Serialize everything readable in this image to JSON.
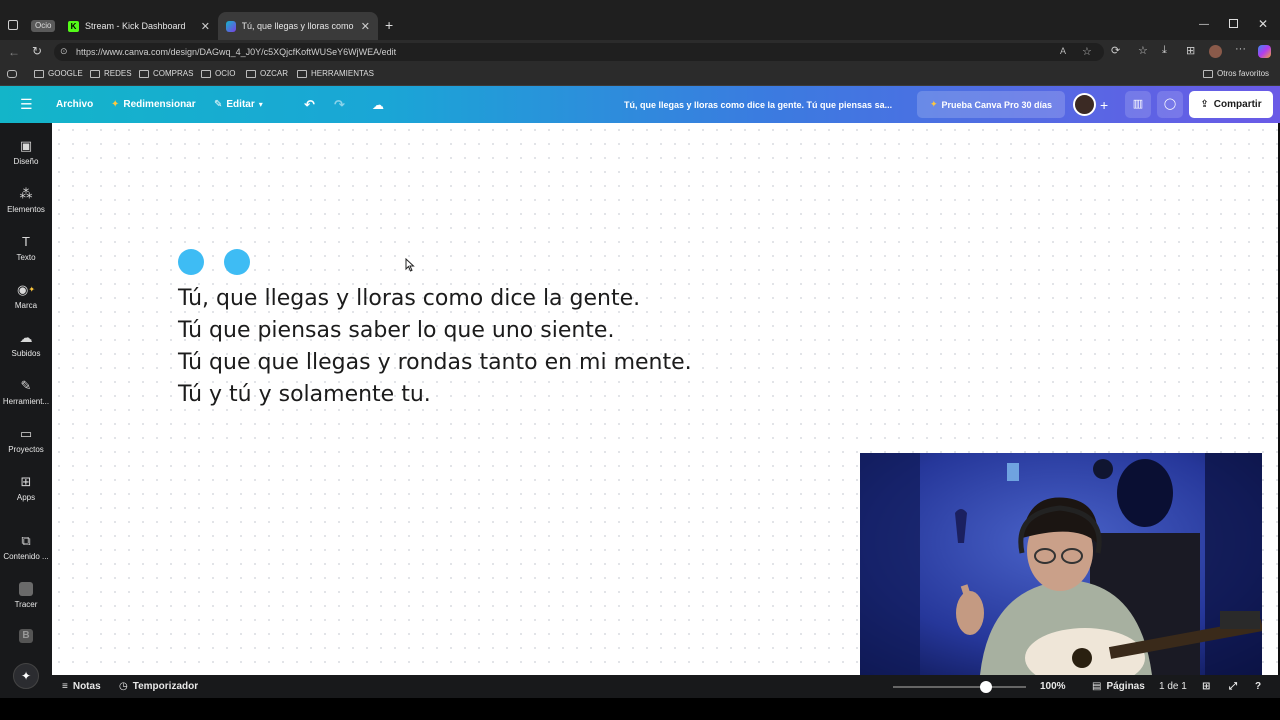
{
  "browser": {
    "tabs": [
      {
        "label": "Ocio",
        "kind": "group"
      },
      {
        "label": "Stream - Kick Dashboard"
      },
      {
        "label": "Tú, que llegas y lloras como dice"
      }
    ],
    "url": "https://www.canva.com/design/DAGwq_4_J0Y/c5XQjcfKoftWUSeY6WjWEA/edit",
    "bookmarks": [
      "GOOGLE",
      "REDES",
      "COMPRAS",
      "OCIO",
      "OZCAR",
      "HERRAMIENTAS"
    ],
    "other_bookmarks": "Otros favoritos"
  },
  "canva": {
    "menu": {
      "archivo": "Archivo",
      "redimensionar": "Redimensionar",
      "editar": "Editar"
    },
    "doc_title": "Tú, que llegas y lloras como dice la gente. Tú que piensas sa...",
    "pro_trial": "Prueba Canva Pro 30 días",
    "share": "Compartir",
    "rail": [
      {
        "label": "Diseño",
        "icon": "layout-icon"
      },
      {
        "label": "Elementos",
        "icon": "elements-icon"
      },
      {
        "label": "Texto",
        "icon": "text-icon"
      },
      {
        "label": "Marca",
        "icon": "brand-icon"
      },
      {
        "label": "Subidos",
        "icon": "upload-icon"
      },
      {
        "label": "Herramient...",
        "icon": "pen-icon"
      },
      {
        "label": "Proyectos",
        "icon": "folder-icon"
      },
      {
        "label": "Apps",
        "icon": "apps-icon"
      },
      {
        "label": "Contenido ...",
        "icon": "content-icon"
      },
      {
        "label": "Tracer",
        "icon": "tracer-icon"
      }
    ],
    "lyrics": [
      "Tú, que llegas y lloras como dice la gente.",
      "Tú que piensas saber lo que uno siente.",
      "Tú que que llegas y rondas tanto en mi mente.",
      "Tú y tú y solamente tu."
    ],
    "footer": {
      "notes": "Notas",
      "timer": "Temporizador",
      "zoom": "100%",
      "zoom_level": 0.7,
      "pages_label": "Páginas",
      "pages_count": "1 de 1"
    }
  },
  "colors": {
    "accent_dots": "#3ebcf4",
    "header_gradient_start": "#13b5c9",
    "header_gradient_end": "#6a5ae6"
  }
}
